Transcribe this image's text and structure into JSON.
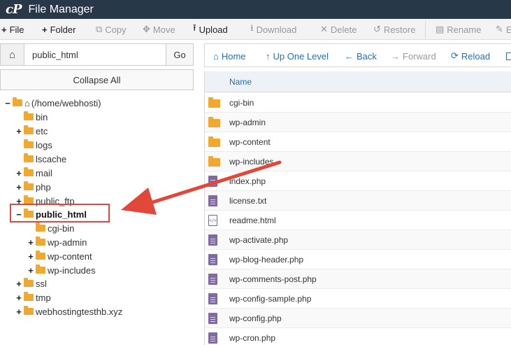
{
  "app": {
    "logo": "cP",
    "title": "File Manager"
  },
  "toolbar": {
    "items": [
      {
        "label": "File",
        "icon": "+",
        "icon_name": "plus-icon",
        "enabled": true
      },
      {
        "label": "Folder",
        "icon": "+",
        "icon_name": "plus-icon",
        "enabled": true
      },
      {
        "label": "Copy",
        "icon": "⧉",
        "icon_name": "copy-icon",
        "enabled": false
      },
      {
        "label": "Move",
        "icon": "✥",
        "icon_name": "move-icon",
        "enabled": false
      },
      {
        "label": "Upload",
        "icon": "⭱",
        "icon_name": "upload-icon",
        "enabled": true
      },
      {
        "label": "Download",
        "icon": "⭳",
        "icon_name": "download-icon",
        "enabled": false
      },
      {
        "label": "Delete",
        "icon": "✕",
        "icon_name": "delete-icon",
        "enabled": false
      },
      {
        "label": "Restore",
        "icon": "↺",
        "icon_name": "restore-icon",
        "enabled": false
      },
      {
        "label": "Rename",
        "icon": "▤",
        "icon_name": "rename-icon",
        "enabled": false
      },
      {
        "label": "E",
        "icon": "✎",
        "icon_name": "edit-icon",
        "enabled": false
      }
    ]
  },
  "path_bar": {
    "home_icon": "⌂",
    "value": "public_html",
    "go_label": "Go"
  },
  "collapse_label": "Collapse All",
  "tree": {
    "root_label": "(/home/webhosti)",
    "items": [
      {
        "label": "bin",
        "expander": ""
      },
      {
        "label": "etc",
        "expander": "+"
      },
      {
        "label": "logs",
        "expander": ""
      },
      {
        "label": "lscache",
        "expander": ""
      },
      {
        "label": "mail",
        "expander": "+"
      },
      {
        "label": "php",
        "expander": "+"
      },
      {
        "label": "public_ftp",
        "expander": "+"
      },
      {
        "label": "public_html",
        "expander": "−"
      },
      {
        "label": "cgi-bin",
        "expander": ""
      },
      {
        "label": "wp-admin",
        "expander": "+"
      },
      {
        "label": "wp-content",
        "expander": "+"
      },
      {
        "label": "wp-includes",
        "expander": "+"
      },
      {
        "label": "ssl",
        "expander": "+"
      },
      {
        "label": "tmp",
        "expander": "+"
      },
      {
        "label": "webhostingtesthb.xyz",
        "expander": "+"
      }
    ]
  },
  "nav": {
    "home": "Home",
    "up": "Up One Level",
    "back": "Back",
    "forward": "Forward",
    "reload": "Reload"
  },
  "files": {
    "header_name": "Name",
    "rows": [
      {
        "name": "cgi-bin",
        "type": "folder"
      },
      {
        "name": "wp-admin",
        "type": "folder"
      },
      {
        "name": "wp-content",
        "type": "folder"
      },
      {
        "name": "wp-includes",
        "type": "folder"
      },
      {
        "name": "index.php",
        "type": "php"
      },
      {
        "name": "license.txt",
        "type": "php"
      },
      {
        "name": "readme.html",
        "type": "html"
      },
      {
        "name": "wp-activate.php",
        "type": "php"
      },
      {
        "name": "wp-blog-header.php",
        "type": "php"
      },
      {
        "name": "wp-comments-post.php",
        "type": "php"
      },
      {
        "name": "wp-config-sample.php",
        "type": "php"
      },
      {
        "name": "wp-config.php",
        "type": "php"
      },
      {
        "name": "wp-cron.php",
        "type": "php"
      }
    ]
  },
  "colors": {
    "title_bar": "#283848",
    "link_blue": "#2a6fb5",
    "folder": "#f0a830",
    "annotation_red": "#e2483a"
  }
}
